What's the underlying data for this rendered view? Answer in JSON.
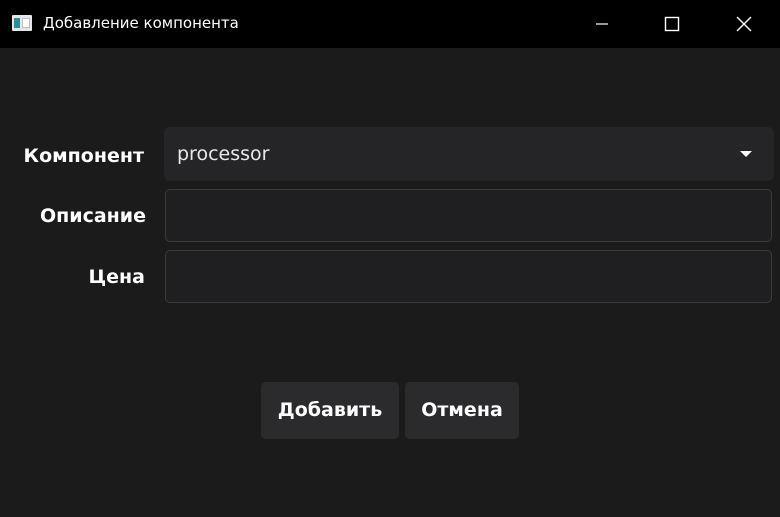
{
  "window": {
    "title": "Добавление компонента",
    "controls": {
      "minimize": "minimize-icon",
      "maximize": "maximize-icon",
      "close": "close-icon"
    }
  },
  "form": {
    "component_label": "Компонент",
    "component_value": "processor",
    "description_label": "Описание",
    "description_value": "",
    "price_label": "Цена",
    "price_value": ""
  },
  "buttons": {
    "add_label": "Добавить",
    "cancel_label": "Отмена"
  },
  "colors": {
    "background": "#1b1b1c",
    "titlebar": "#000000",
    "input_bg": "#252527",
    "button_bg": "#2b2b2e",
    "text": "#ffffff"
  }
}
